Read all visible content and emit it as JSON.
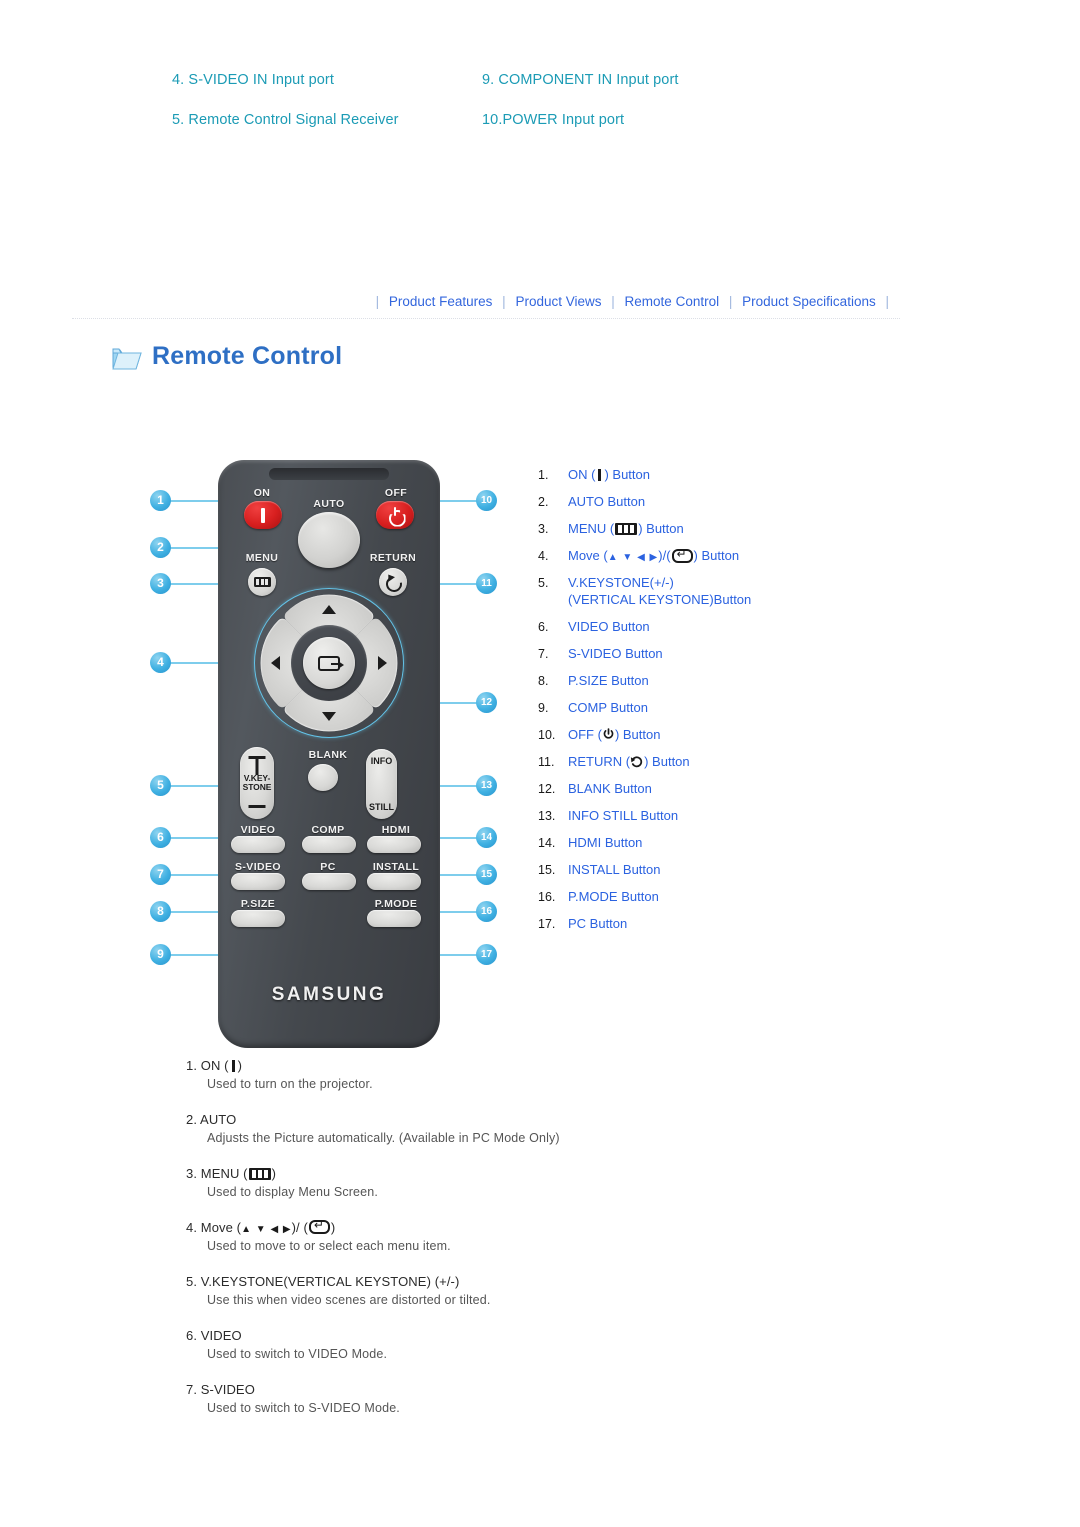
{
  "ports": {
    "left": [
      "4. S-VIDEO IN Input port",
      "5. Remote Control Signal Receiver"
    ],
    "right": [
      "9. COMPONENT IN Input port",
      "10.POWER Input port"
    ]
  },
  "nav": {
    "items": [
      "Product Features",
      "Product Views",
      "Remote Control",
      "Product Specifications"
    ],
    "separator": "|"
  },
  "section": {
    "title": "Remote Control",
    "icon": "folder-icon"
  },
  "legend": {
    "items": [
      {
        "num": "1.",
        "label": "ON (",
        "label2": ") Button",
        "icon": "on-bar-icon"
      },
      {
        "num": "2.",
        "label": "AUTO Button"
      },
      {
        "num": "3.",
        "label": "MENU (",
        "label2": ") Button",
        "icon": "menu-icon"
      },
      {
        "num": "4.",
        "label": "Move (",
        "label2": ")/(",
        "label3": ") Button",
        "icon": "arrows-icon"
      },
      {
        "num": "5.",
        "label": "V.KEYSTONE(+/-)",
        "label2": "(VERTICAL KEYSTONE)Button"
      },
      {
        "num": "6.",
        "label": "VIDEO Button"
      },
      {
        "num": "7.",
        "label": "S-VIDEO Button"
      },
      {
        "num": "8.",
        "label": "P.SIZE Button"
      },
      {
        "num": "9.",
        "label": "COMP Button"
      },
      {
        "num": "10.",
        "label": "OFF (",
        "label2": ") Button",
        "icon": "power-icon"
      },
      {
        "num": "11.",
        "label": "RETURN (",
        "label2": ") Button",
        "icon": "return-icon"
      },
      {
        "num": "12.",
        "label": "BLANK Button"
      },
      {
        "num": "13.",
        "label": "INFO STILL Button"
      },
      {
        "num": "14.",
        "label": "HDMI Button"
      },
      {
        "num": "15.",
        "label": "INSTALL Button"
      },
      {
        "num": "16.",
        "label": "P.MODE Button"
      },
      {
        "num": "17.",
        "label": "PC Button"
      }
    ]
  },
  "remote": {
    "brand": "SAMSUNG",
    "labels": {
      "on": "ON",
      "auto": "AUTO",
      "off": "OFF",
      "menu": "MENU",
      "return": "RETURN",
      "vkeystone_line1": "V.KEY-",
      "vkeystone_line2": "STONE",
      "blank": "BLANK",
      "info": "INFO",
      "still": "STILL",
      "video": "VIDEO",
      "comp": "COMP",
      "hdmi": "HDMI",
      "svideo": "S-VIDEO",
      "pc": "PC",
      "install": "INSTALL",
      "psize": "P.SIZE",
      "pmode": "P.MODE"
    },
    "callouts": [
      "1",
      "2",
      "3",
      "4",
      "5",
      "6",
      "7",
      "8",
      "9",
      "10",
      "11",
      "12",
      "13",
      "14",
      "15",
      "16",
      "17"
    ]
  },
  "descriptions": [
    {
      "num": "1.",
      "title": "ON (",
      "title2": ")",
      "icon": "on-bar-icon",
      "body": "Used to turn on the projector."
    },
    {
      "num": "2.",
      "title": "AUTO",
      "body": "Adjusts the Picture automatically. (Available in PC Mode Only)"
    },
    {
      "num": "3.",
      "title": "MENU (",
      "title2": ")",
      "icon": "menu-icon",
      "body": "Used to display Menu Screen."
    },
    {
      "num": "4.",
      "title": "Move (",
      "title2": ")/ (",
      "title3": ")",
      "icon": "arrows-icon",
      "body": "Used to move to or select each menu item."
    },
    {
      "num": "5.",
      "title": "V.KEYSTONE(VERTICAL KEYSTONE) (+/-)",
      "body": "Use this when video scenes are distorted or tilted."
    },
    {
      "num": "6.",
      "title": "VIDEO",
      "body": "Used to switch to VIDEO Mode."
    },
    {
      "num": "7.",
      "title": "S-VIDEO",
      "body": "Used to switch to S-VIDEO Mode."
    }
  ],
  "colors": {
    "port_text": "#1b9bb5",
    "nav_link": "#3366dd",
    "heading": "#2e6fc4",
    "legend_label": "#2b62e0",
    "callout": "#3fb0e2",
    "button_red": "#d81f1f",
    "remote_body": "#4a4e53"
  }
}
